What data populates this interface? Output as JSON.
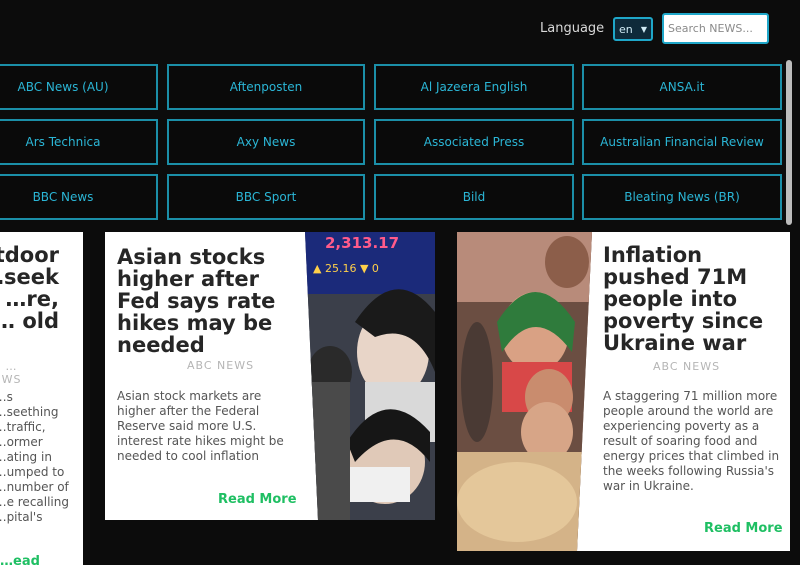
{
  "header": {
    "language_label": "Language",
    "language_value": "en",
    "search_placeholder": "Search NEWS..."
  },
  "sources": [
    "ABC News (AU)",
    "Aftenposten",
    "Al Jazeera English",
    "ANSA.it",
    "Ars Technica",
    "Axy News",
    "Associated Press",
    "Australian Financial Review",
    "BBC News",
    "BBC Sport",
    "Bild",
    "Bleating News (BR)"
  ],
  "articles": [
    {
      "title": "…tdoor\n…seek\n…re,\n… old",
      "source": "…WS",
      "description": "…s\n…seething\n…traffic,\n…ormer\n…ating in\n…umped to\n…number of\n…e recalling\n…pital's",
      "more": "…ead More"
    },
    {
      "title": "Asian stocks higher after Fed says rate hikes may be needed",
      "source": "ABC NEWS",
      "description": "Asian stock markets are higher after the Federal Reserve said more U.S. interest rate hikes might be needed to cool inflation",
      "more": "Read More",
      "ticker_top": "2,313.17",
      "ticker_bottom": "▲ 25.16 ▼ 0"
    },
    {
      "title": "Inflation pushed 71M people into poverty since Ukraine war",
      "source": "ABC NEWS",
      "description": "A staggering 71 million more people around the world are experiencing poverty as a result of soaring food and energy prices that climbed in the weeks following Russia's war in Ukraine.",
      "more": "Read More"
    }
  ],
  "colors": {
    "accent": "#1fa7c9",
    "read_more": "#1fbf63",
    "background": "#0c0c0c"
  }
}
